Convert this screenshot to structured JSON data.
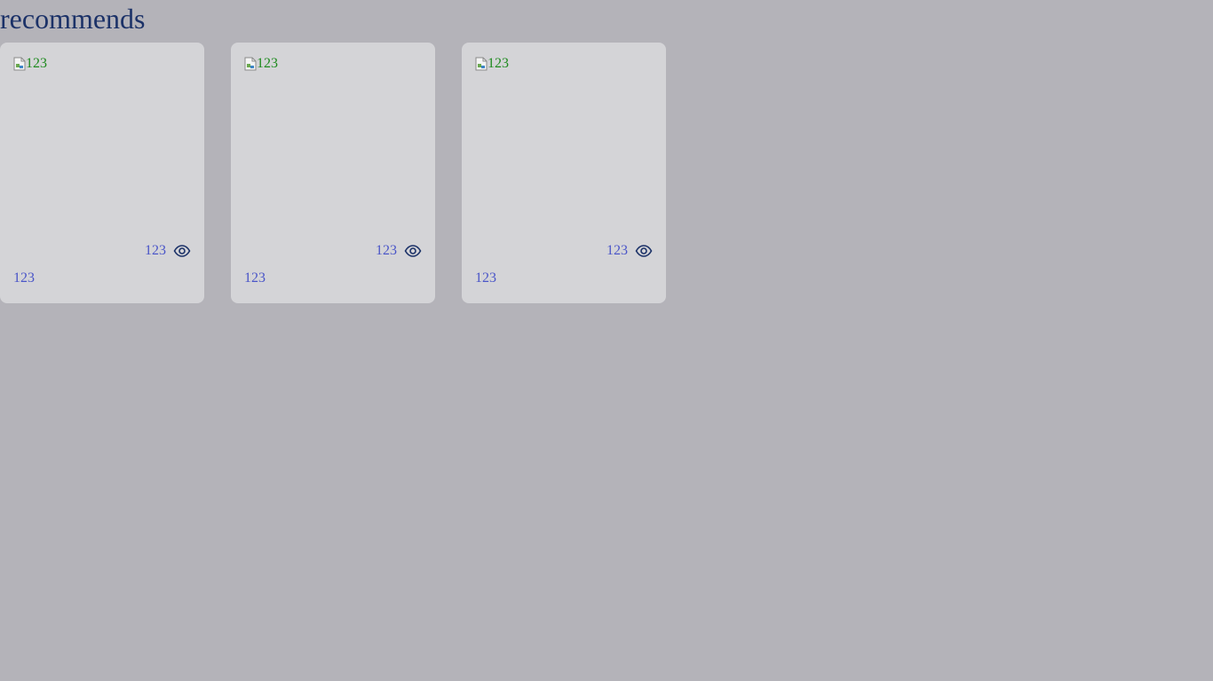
{
  "page": {
    "title": "recommends"
  },
  "cards": [
    {
      "image_alt": "123",
      "views": "123",
      "name": "123"
    },
    {
      "image_alt": "123",
      "views": "123",
      "name": "123"
    },
    {
      "image_alt": "123",
      "views": "123",
      "name": "123"
    }
  ],
  "icons": {
    "views": "eye-icon",
    "image_placeholder": "broken-image-icon"
  },
  "colors": {
    "background": "#b4b3b9",
    "card": "#d4d4d7",
    "title": "#1c3268",
    "alt_text": "#1e8a1e",
    "meta_text": "#4a55c8",
    "icon": "#1c3268"
  }
}
